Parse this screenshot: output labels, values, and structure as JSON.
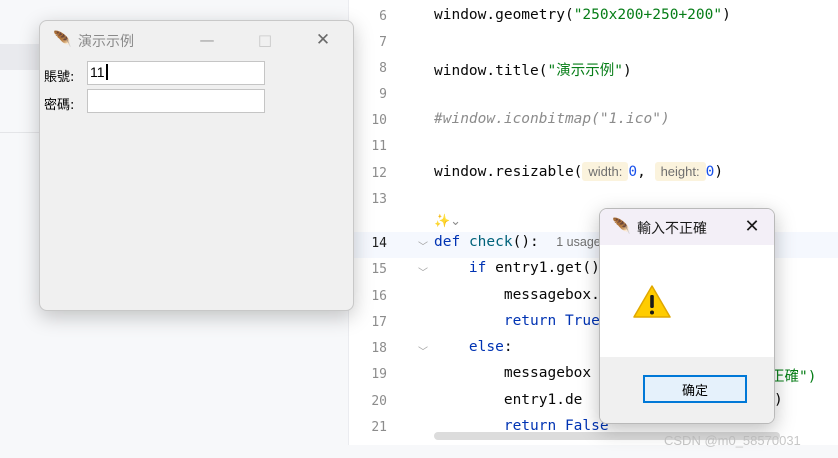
{
  "editor": {
    "lines": [
      {
        "num": "6",
        "code": "window.geometry(\"250x200+250+200\")"
      },
      {
        "num": "7",
        "code": ""
      },
      {
        "num": "8",
        "code": "window.title(\"演示示例\")"
      },
      {
        "num": "9",
        "code": ""
      },
      {
        "num": "10",
        "code": "#window.iconbitmap(\"1.ico\")"
      },
      {
        "num": "11",
        "code": ""
      },
      {
        "num": "12",
        "code": "window.resizable("
      },
      {
        "num": "13",
        "code": ""
      },
      {
        "num": "14",
        "code": "def check():"
      },
      {
        "num": "15",
        "code": "    if entry1.get()"
      },
      {
        "num": "16",
        "code": "        messagebox."
      },
      {
        "num": "17",
        "code": "        return True"
      },
      {
        "num": "18",
        "code": "    else:"
      },
      {
        "num": "19",
        "code": "        messagebox"
      },
      {
        "num": "20",
        "code": "        entry1.de"
      },
      {
        "num": "21",
        "code": "        return False"
      }
    ],
    "inlay_width": "width:",
    "inlay_width_val": "0",
    "inlay_height": "height:",
    "inlay_height_val": "0",
    "usage_hint": "1 usage",
    "partial_right_19": "正確\")",
    "partial_right_20": ")"
  },
  "tk_window": {
    "title": "演示示例",
    "minimize": "—",
    "maximize": "□",
    "close": "✕",
    "account_label": "賬號:",
    "account_value": "11",
    "password_label": "密碼:",
    "password_value": ""
  },
  "message_box": {
    "title": "輸入不正確",
    "close": "✕",
    "ok_label": "确定"
  },
  "watermark": "CSDN @m0_58570031",
  "icons": {
    "app_icon": "feather-icon",
    "warning": "warning-icon"
  },
  "colors": {
    "string": "#067d17",
    "keyword": "#0033b3",
    "comment": "#8c8c8c",
    "number": "#1750eb",
    "accent": "#0078d7"
  }
}
